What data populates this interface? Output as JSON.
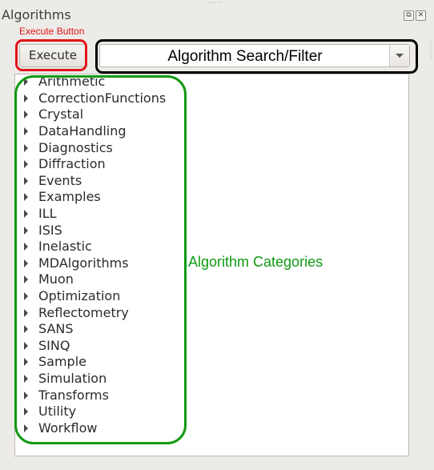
{
  "dock": {
    "title": "Algorithms",
    "float_button_glyph": "⧉",
    "close_button_glyph": "✕"
  },
  "toolbar": {
    "execute_label": "Execute",
    "search_placeholder": "Algorithm Search/Filter",
    "search_value": ""
  },
  "annotations": {
    "execute_label": "Execute Button",
    "categories_label": "Algorithm Categories",
    "colors": {
      "execute": "#e0141b",
      "search": "#000000",
      "categories": "#0f9a11"
    }
  },
  "categories": [
    {
      "label": "Arithmetic"
    },
    {
      "label": "CorrectionFunctions"
    },
    {
      "label": "Crystal"
    },
    {
      "label": "DataHandling"
    },
    {
      "label": "Diagnostics"
    },
    {
      "label": "Diffraction"
    },
    {
      "label": "Events"
    },
    {
      "label": "Examples"
    },
    {
      "label": "ILL"
    },
    {
      "label": "ISIS"
    },
    {
      "label": "Inelastic"
    },
    {
      "label": "MDAlgorithms"
    },
    {
      "label": "Muon"
    },
    {
      "label": "Optimization"
    },
    {
      "label": "Reflectometry"
    },
    {
      "label": "SANS"
    },
    {
      "label": "SINQ"
    },
    {
      "label": "Sample"
    },
    {
      "label": "Simulation"
    },
    {
      "label": "Transforms"
    },
    {
      "label": "Utility"
    },
    {
      "label": "Workflow"
    }
  ]
}
